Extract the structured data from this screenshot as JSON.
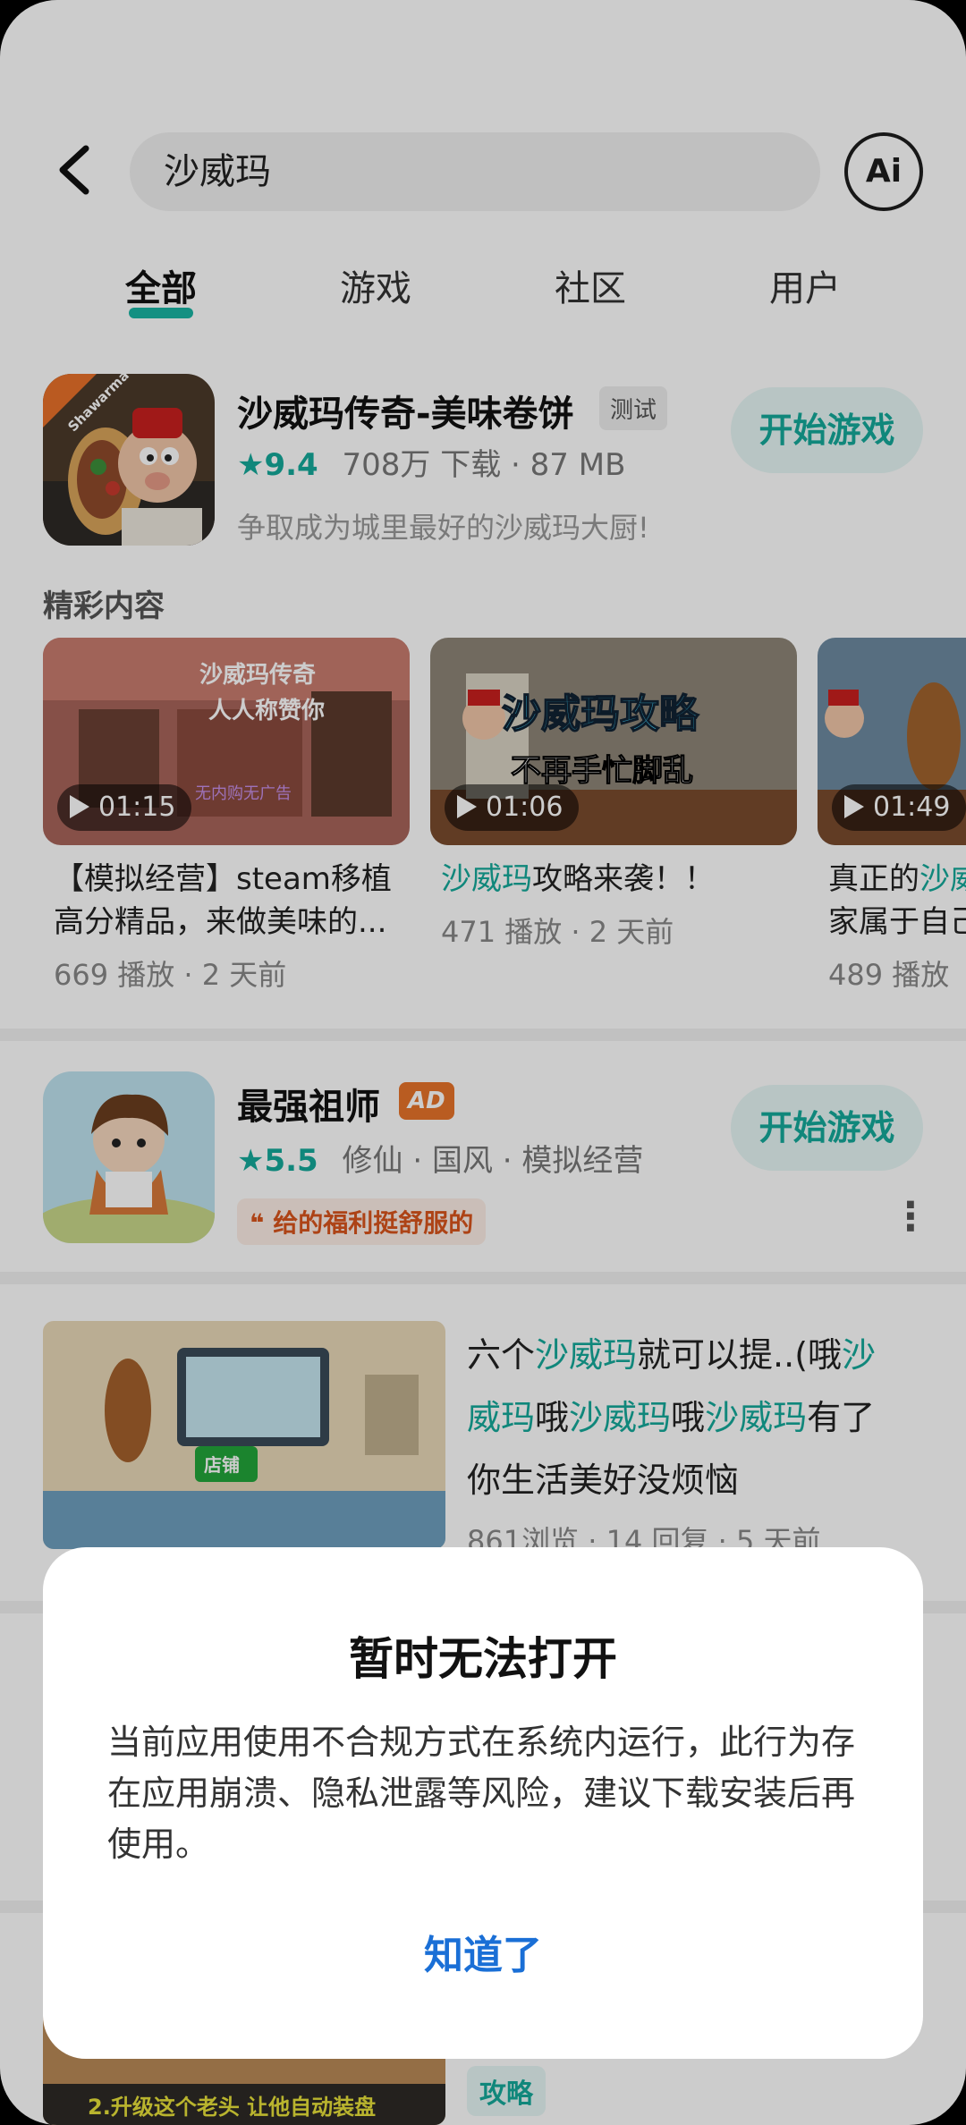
{
  "search": {
    "query": "沙威玛"
  },
  "ai_label": "Ai",
  "tabs": [
    "全部",
    "游戏",
    "社区",
    "用户"
  ],
  "app1": {
    "name": "沙威玛传奇-美味卷饼",
    "badge": "测试",
    "rating": "9.4",
    "meta": "708万 下载 · 87 MB",
    "desc": "争取成为城里最好的沙威玛大厨!",
    "button": "开始游戏",
    "icon_text": "Shawarma"
  },
  "section_label": "精彩内容",
  "videos": [
    {
      "duration": "01:15",
      "title_line1": "【模拟经营】steam移植",
      "title_line2": "高分精品，来做美味的...",
      "stats": "669 播放 · 2 天前",
      "thumb_text1": "沙威玛传奇",
      "thumb_text2": "人人称赞你",
      "thumb_text3": "无内购无广告"
    },
    {
      "duration": "01:06",
      "title_hl": "沙威玛",
      "title_rest": "攻略来袭！！",
      "stats": "471 播放 · 2 天前",
      "thumb_text1": "沙威玛攻略",
      "thumb_text2": "不再手忙脚乱"
    },
    {
      "duration": "01:49",
      "title_pre": "真正的",
      "title_hl": "沙威",
      "title_line2": "家属于自己",
      "stats": "489 播放"
    }
  ],
  "app2": {
    "name": "最强祖师",
    "badge": "AD",
    "rating": "5.5",
    "meta": "修仙 · 国风 · 模拟经营",
    "tag": "给的福利挺舒服的",
    "button": "开始游戏"
  },
  "post1": {
    "seg": [
      "六个",
      "沙威玛",
      "就可以提..(哦",
      "沙",
      "威玛",
      "哦",
      "沙威玛",
      "哦",
      "沙威玛",
      "有了",
      "你生活美好没烦恼"
    ],
    "stats": "861浏览 · 14 回复 · 5 天前",
    "thumb_text": "店铺"
  },
  "post2": {
    "thumb_caption": "2.升级这个老头 让他自动装盘",
    "chip": "攻略"
  },
  "dialog": {
    "title": "暂时无法打开",
    "body": "当前应用使用不合规方式在系统内运行，此行为存在应用崩溃、隐私泄露等风险，建议下载安装后再使用。",
    "button": "知道了"
  },
  "colors": {
    "accent": "#14a99a",
    "dialog_button": "#1a6fd6",
    "ad_badge": "#e8742a"
  }
}
